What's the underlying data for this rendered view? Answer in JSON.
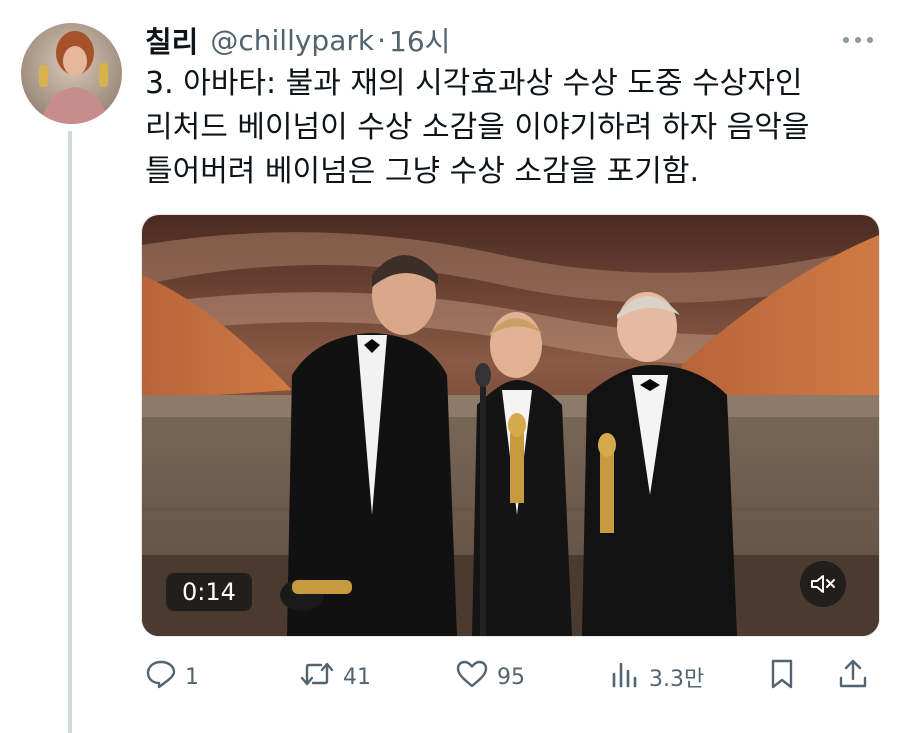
{
  "tweet": {
    "display_name": "칠리",
    "handle": "@chillypark",
    "separator": "·",
    "time": "16시",
    "text_lines": [
      "3. 아바타: 불과 재의 시각효과상 수상 도중 수상자인",
      "리처드 베이넘이 수상 소감을 이야기하려 하자 음악을",
      "틀어버려 베이넘은 그냥 수상 소감을 포기함."
    ],
    "video": {
      "timestamp": "0:14",
      "mute_icon": "speaker-muted-icon"
    },
    "actions": {
      "reply_count": "1",
      "retweet_count": "41",
      "like_count": "95",
      "views_count": "3.3만"
    }
  },
  "colors": {
    "text": "#0f1419",
    "secondary": "#536471",
    "thread_line": "#cfd9de"
  },
  "icons": [
    "more-icon",
    "reply-icon",
    "retweet-icon",
    "like-icon",
    "views-icon",
    "bookmark-icon",
    "share-icon",
    "speaker-muted-icon"
  ]
}
